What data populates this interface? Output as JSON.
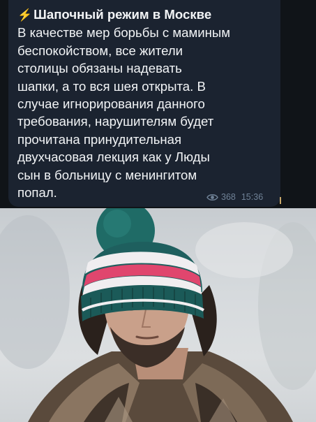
{
  "message": {
    "title": "Шапочный режим в Москве",
    "lines": [
      "В качестве мер борьбы с маминым",
      "беспокойством, все жители",
      "столицы обязаны надевать",
      "шапки, а то вся шея открыта. В",
      "случае игнорирования данного",
      "требования, нарушителям будет",
      "прочитана принудительная",
      "двухчасовая лекция как у Люды",
      "сын в больницу с менингитом",
      "попал."
    ],
    "views": "368",
    "time": "15:36",
    "title_icon": "lightning-icon",
    "view_icon": "eye-icon"
  },
  "colors": {
    "bubble": "#1b2330",
    "text": "#f2f4f6",
    "meta": "#6f8196",
    "hat_pink": "#e0466e",
    "hat_teal": "#1e5f5e"
  }
}
